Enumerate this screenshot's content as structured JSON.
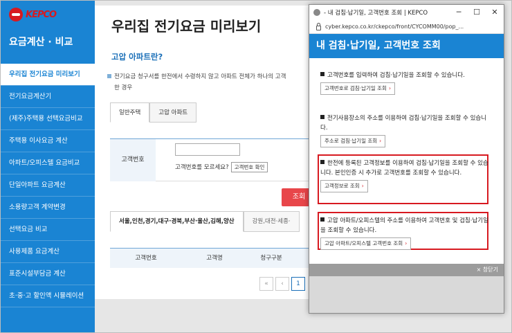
{
  "sidebar": {
    "logo_text": "KEPCO",
    "title": "요금계산 · 비교",
    "items": [
      {
        "label": "우리집 전기요금 미리보기"
      },
      {
        "label": "전기요금계산기"
      },
      {
        "label": "(제주)주택용 선택요금비교"
      },
      {
        "label": "주택용 이사요금 계산"
      },
      {
        "label": "아파트/오피스텔 요금비교"
      },
      {
        "label": "단일아파트 요금계산"
      },
      {
        "label": "소용량고객 계약변경"
      },
      {
        "label": "선택요금 비교"
      },
      {
        "label": "사용제품 요금계산"
      },
      {
        "label": "표준시설부담금 계산"
      },
      {
        "label": "초·중·고 할인액 시뮬레이션"
      }
    ]
  },
  "main": {
    "title": "우리집 전기요금 미리보기",
    "subtitle": "고압 아파트란?",
    "description": "전기요금 청구서를 한전에서 수령하지 않고 아파트 전체가 하나의 고객",
    "description_cont": "한 경우",
    "tabs": [
      {
        "label": "일반주택"
      },
      {
        "label": "고압 아파트"
      }
    ],
    "form": {
      "label": "고객번호",
      "help_text": "고객번호를 모르세요?",
      "confirm_button": "고객번호 확인"
    },
    "search_button": "조회",
    "region_tabs": [
      {
        "label": "서울,인천,경기,대구·경북,부산·울산,김해,양산"
      },
      {
        "label": "강원,대전·세종·"
      }
    ],
    "table_headers": [
      "고객번호",
      "고객명",
      "청구구분"
    ],
    "pager": {
      "first": "«",
      "prev": "‹",
      "current": "1"
    }
  },
  "popup": {
    "window_title": "- 내 검침·납기일, 고객번호 조회 | KEPCO",
    "url": "cyber.kepco.co.kr/ckepco/front/CYCOMM00/pop_...",
    "header": "내 검침·납기일, 고객번호 조회",
    "sections": [
      {
        "text": "고객번호를 입력하여 검침·납기일을 조회할 수 있습니다.",
        "button": "고객번호로 검침·납기일 조회"
      },
      {
        "text": "전기사용장소의 주소를 이용하여 검침·납기일을 조회할 수 있습니다.",
        "button": "주소로 검침·납기일 조회"
      },
      {
        "text": "한전에 등록된 고객정보를 이용하여 검침·납기일을 조회할 수 있습니다. 본인인증 시 추가로 고객번호를 조회할 수 있습니다.",
        "button": "고객정보로 조회"
      },
      {
        "text": "고압 아파트/오피스텔의 주소를 이용하여 고객번호 및 검침·납기일을 조회할 수 있습니다.",
        "button": "고압 아파트/오피스텔 고객번호 조회"
      }
    ],
    "close_label": "× 창닫기"
  },
  "colors": {
    "primary": "#1a84d3",
    "accent": "#e8464a",
    "highlight": "#d71920"
  }
}
